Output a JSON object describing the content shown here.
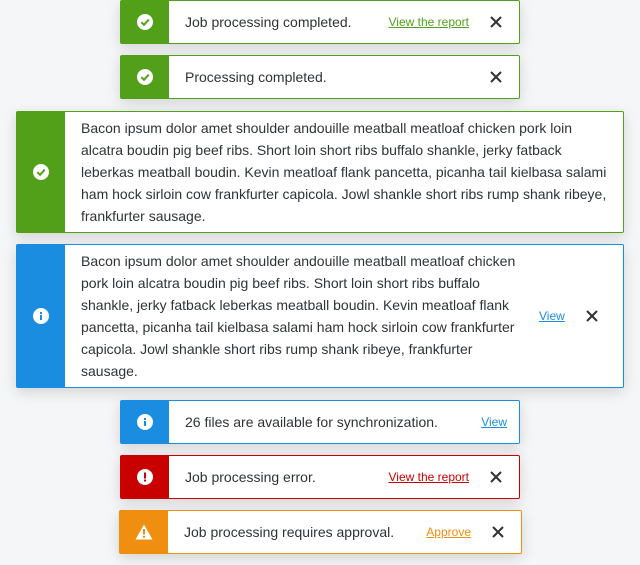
{
  "colors": {
    "success": "#52a019",
    "info": "#1b8de0",
    "error": "#c80000",
    "warning": "#f08e0f"
  },
  "toasts": [
    {
      "type": "success",
      "icon": "check-circle-icon",
      "message": "Job processing completed.",
      "link": "View the report",
      "close": true
    },
    {
      "type": "success",
      "icon": "check-circle-icon",
      "message": "Processing completed.",
      "link": "",
      "close": true
    },
    {
      "type": "success",
      "icon": "check-circle-icon",
      "message": "Bacon ipsum dolor amet shoulder andouille meatball meatloaf chicken pork loin alcatra boudin pig beef ribs. Short loin short ribs buffalo shankle, jerky fatback leberkas meatball boudin. Kevin meatloaf flank pancetta, picanha tail kielbasa salami ham hock sirloin cow frankfurter capicola. Jowl shankle short ribs rump shank ribeye, frankfurter sausage.",
      "link": "",
      "close": false
    },
    {
      "type": "info",
      "icon": "info-circle-icon",
      "message": "Bacon ipsum dolor amet shoulder andouille meatball meatloaf chicken pork loin alcatra boudin pig beef ribs. Short loin short ribs buffalo shankle, jerky fatback leberkas meatball boudin. Kevin meatloaf flank pancetta, picanha tail kielbasa salami ham hock sirloin cow frankfurter capicola. Jowl shankle short ribs rump shank ribeye, frankfurter sausage.",
      "link": "View",
      "close": true
    },
    {
      "type": "info",
      "icon": "info-circle-icon",
      "message": "26 files are available for synchronization.",
      "link": "View",
      "close": false
    },
    {
      "type": "error",
      "icon": "exclamation-circle-icon",
      "message": "Job processing error.",
      "link": "View the report",
      "close": true
    },
    {
      "type": "warning",
      "icon": "warning-triangle-icon",
      "message": "Job processing requires approval.",
      "link": "Approve",
      "close": true
    }
  ]
}
